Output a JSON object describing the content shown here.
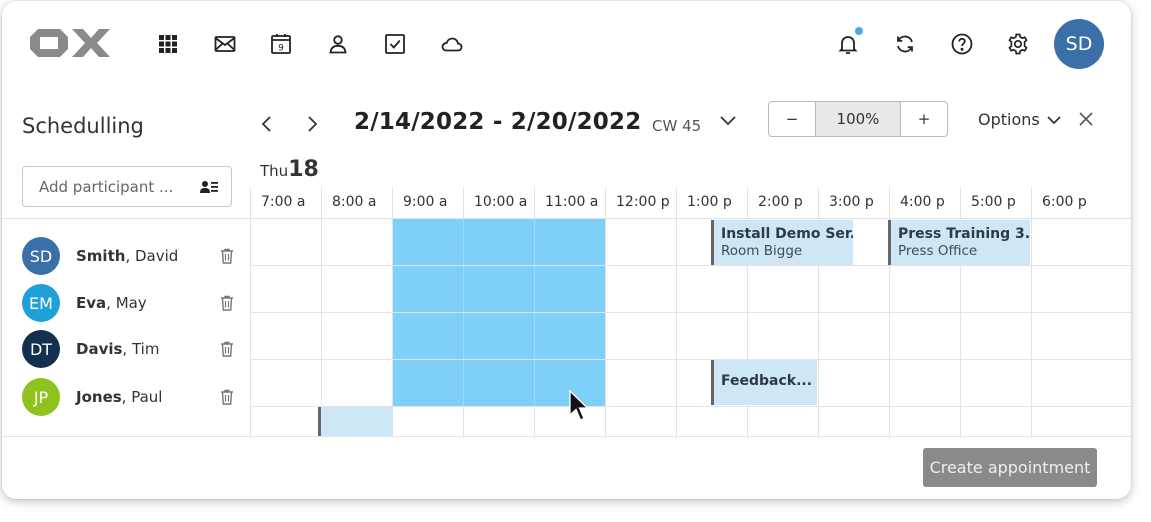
{
  "colors": {
    "accent_avatar": "#3b6fa8",
    "notification_dot": "#4aa8e0",
    "selection": "#7fd0f8",
    "appointment_bg": "#cde7f7",
    "button_disabled": "#8a8a8a"
  },
  "topbar": {
    "icons": [
      "apps-grid-icon",
      "mail-icon",
      "calendar-icon",
      "contacts-icon",
      "tasks-icon",
      "drive-cloud-icon"
    ],
    "calendar_icon_day": "9",
    "user_initials": "SD"
  },
  "scheduling": {
    "title": "Schedulling",
    "date_range": "2/14/2022 - 2/20/2022",
    "calendar_week": "CW 45",
    "zoom": {
      "minus": "−",
      "value": "100%",
      "plus": "+"
    },
    "options_label": "Options",
    "add_participant_placeholder": "Add participant ...",
    "day": {
      "name": "Thu",
      "number": "18"
    },
    "hours": [
      "7:00 a",
      "8:00 a",
      "9:00 a",
      "10:00 a",
      "11:00 a",
      "12:00 p",
      "1:00 p",
      "2:00 p",
      "3:00 p",
      "4:00 p",
      "5:00 p",
      "6:00 p"
    ],
    "participants": [
      {
        "initials": "SD",
        "last": "Smith",
        "first": ", David",
        "color": "#3b6fa8"
      },
      {
        "initials": "EM",
        "last": "Eva",
        "first": ", May",
        "color": "#1ea0d8"
      },
      {
        "initials": "DT",
        "last": "Davis",
        "first": ", Tim",
        "color": "#14304f"
      },
      {
        "initials": "JP",
        "last": "Jones",
        "first": ", Paul",
        "color": "#8ec21e"
      }
    ],
    "appointments": [
      {
        "title": "Install Demo Ser...",
        "location": "Room Bigge"
      },
      {
        "title": "Press Training 3...",
        "location": "Press Office"
      },
      {
        "title": "Feedback...",
        "location": ""
      }
    ],
    "create_button": "Create appointment"
  }
}
